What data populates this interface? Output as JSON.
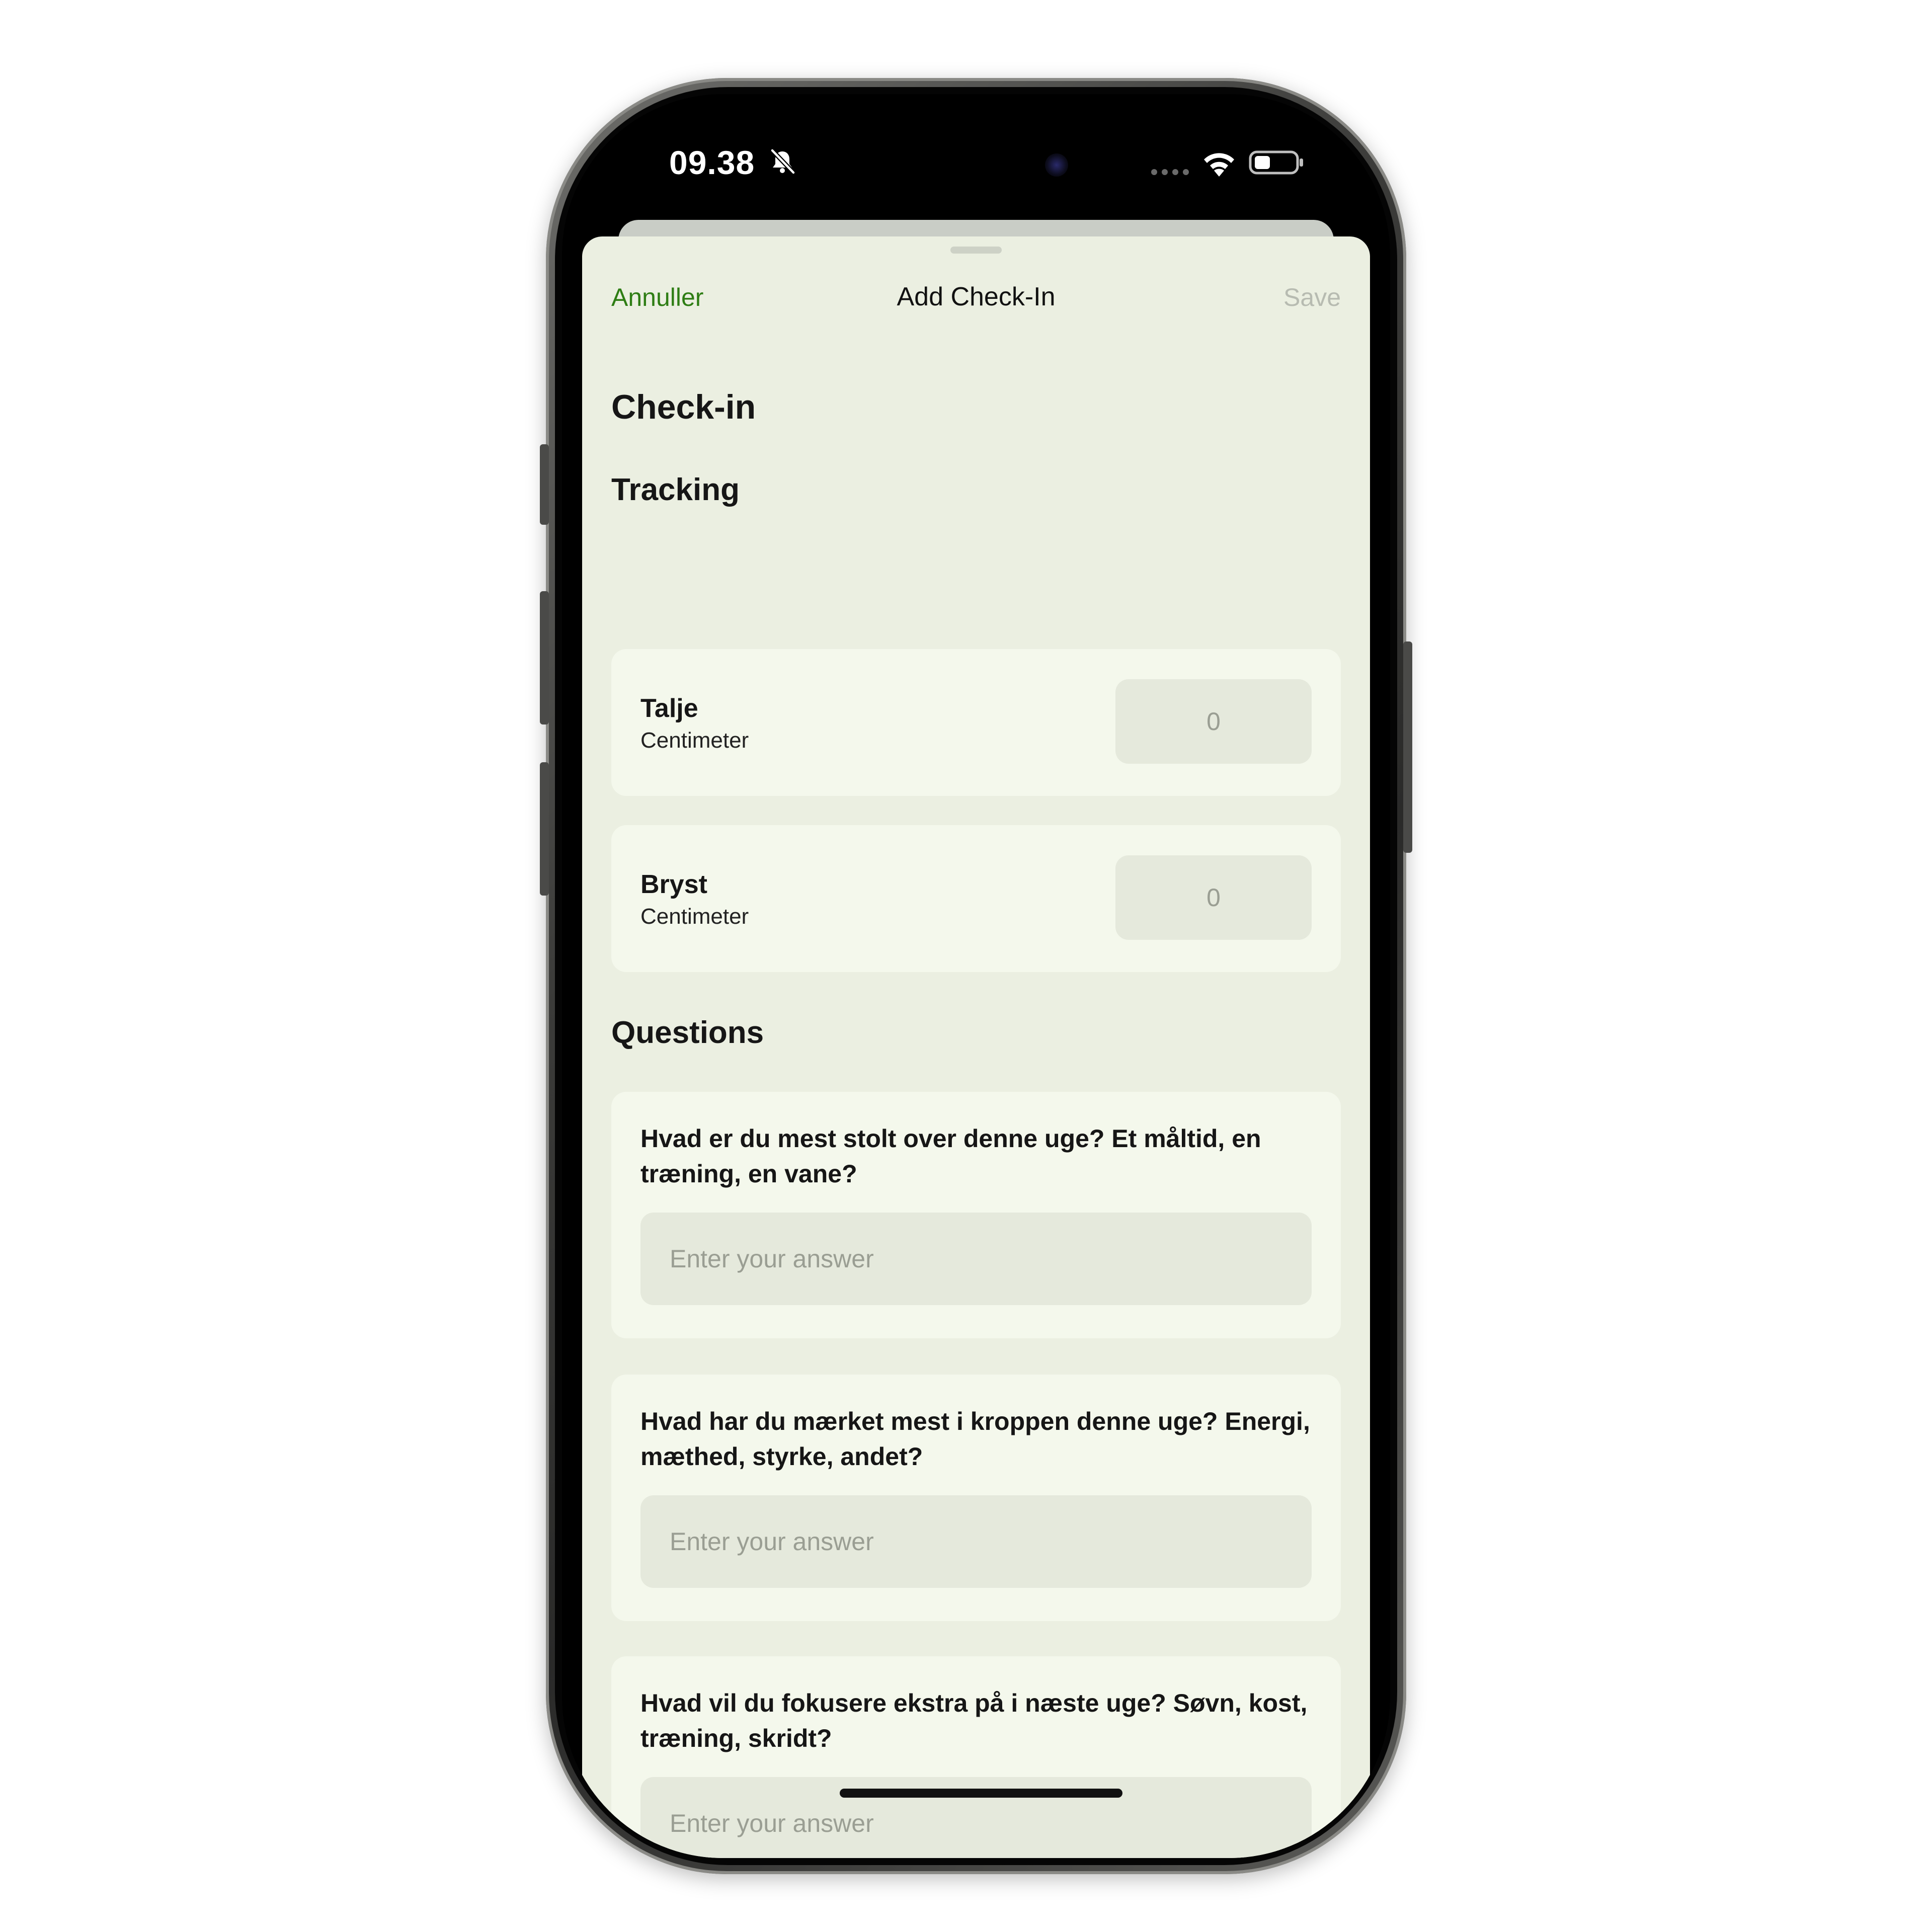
{
  "status_bar": {
    "time": "09.38",
    "mute_icon": "bell-slash-icon",
    "signal_icon": "signal-dots-icon",
    "wifi_icon": "wifi-icon",
    "battery_icon": "battery-icon"
  },
  "nav": {
    "cancel_label": "Annuller",
    "title": "Add Check-In",
    "save_label": "Save"
  },
  "page": {
    "title": "Check-in"
  },
  "tracking": {
    "heading": "Tracking",
    "items": [
      {
        "name": "Talje",
        "unit": "Centimeter",
        "placeholder": "0"
      },
      {
        "name": "Bryst",
        "unit": "Centimeter",
        "placeholder": "0"
      }
    ]
  },
  "questions": {
    "heading": "Questions",
    "items": [
      {
        "text": "Hvad er du mest stolt over denne uge? Et måltid, en træning, en vane?",
        "placeholder": "Enter your answer"
      },
      {
        "text": "Hvad har du mærket mest i kroppen denne uge? Energi, mæthed, styrke, andet?",
        "placeholder": "Enter your answer"
      },
      {
        "text": "Hvad vil du fokusere ekstra på i næste uge? Søvn, kost, træning, skridt?",
        "placeholder": "Enter your answer"
      }
    ]
  },
  "colors": {
    "accent": "#2e7d14",
    "sheet_background": "#ebefe1",
    "card_background": "#f4f8ec",
    "input_background": "#e5e9dc",
    "disabled_text": "#b7bbb1"
  }
}
